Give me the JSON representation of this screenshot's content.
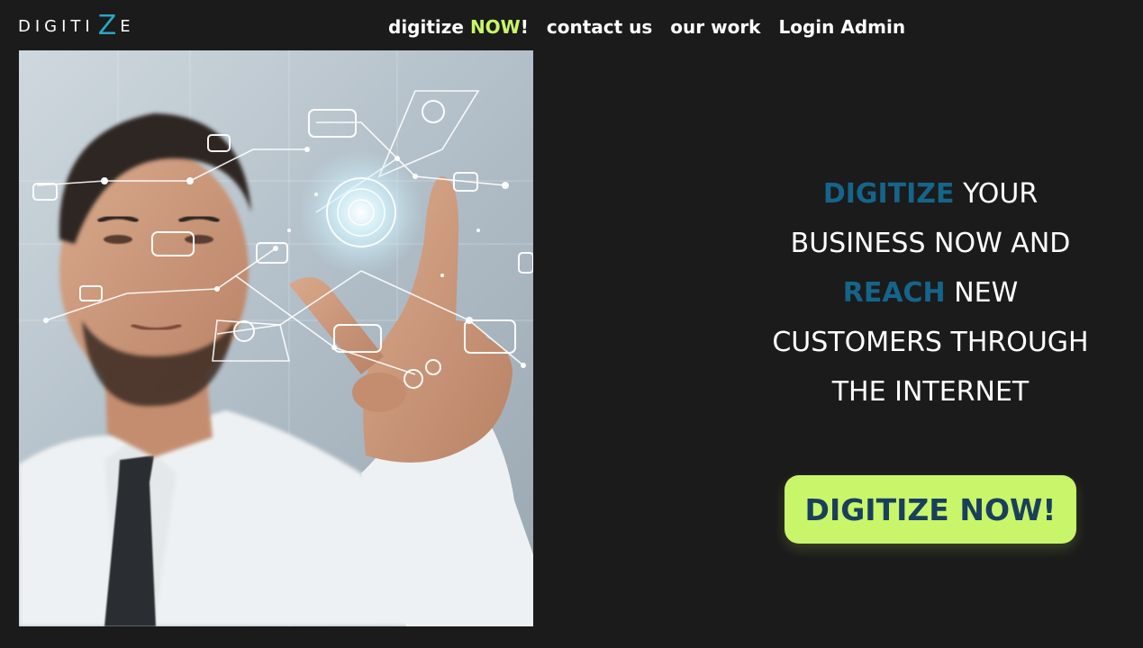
{
  "brand": {
    "logo_left": "DIGITI",
    "logo_z": "Z",
    "logo_right": "E"
  },
  "nav": {
    "digitize_prefix": "digitize ",
    "digitize_accent": "NOW",
    "digitize_suffix": "!",
    "contact": "contact us",
    "work": "our work",
    "login": "Login Admin"
  },
  "hero": {
    "line1_highlight": "DIGITIZE",
    "line1_rest": " YOUR",
    "line2": "BUSINESS NOW AND",
    "line3_highlight": "REACH",
    "line3_rest": " NEW",
    "line4": "CUSTOMERS THROUGH",
    "line5": "THE INTERNET",
    "cta_label": "DIGITIZE NOW!"
  },
  "colors": {
    "background": "#1b1b1b",
    "accent_green": "#c9f56a",
    "accent_blue": "#15648a",
    "cta_text": "#1a3f5c"
  }
}
